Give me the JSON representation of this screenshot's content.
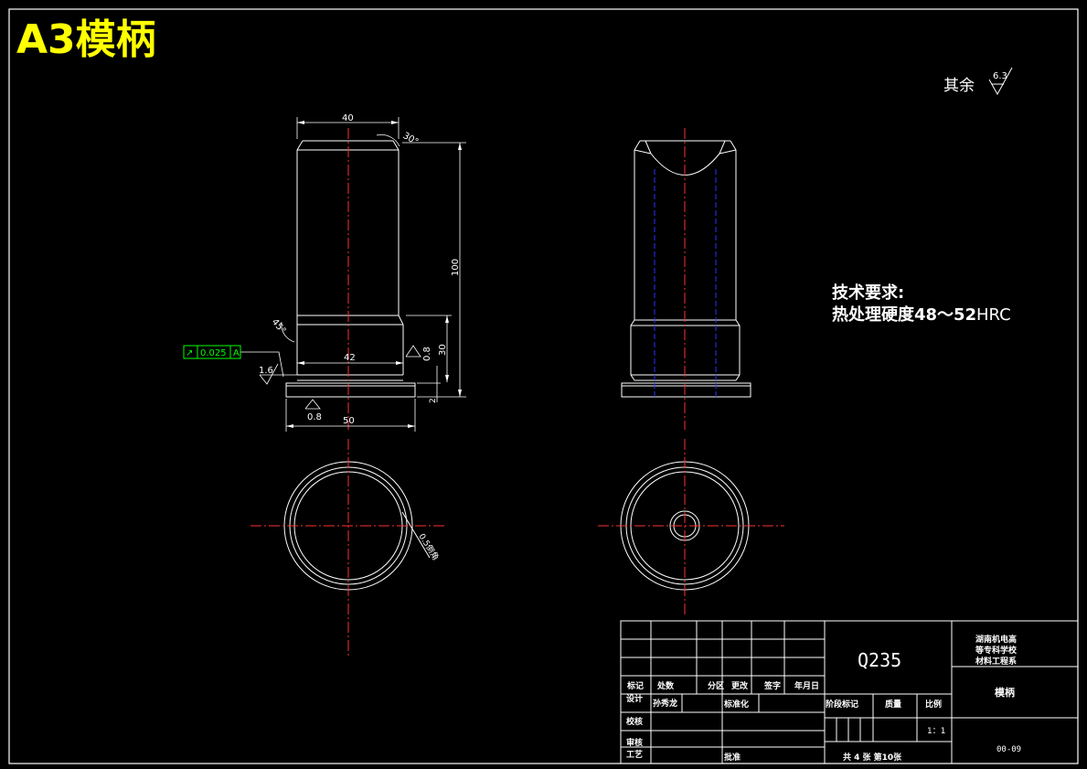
{
  "drawing": {
    "title": "A3模柄",
    "roughness_note": {
      "label": "其余",
      "value": "6.3"
    },
    "tech_requirements": {
      "heading": "技术要求:",
      "line1": "热处理硬度48～52",
      "line1_unit": "HRC"
    },
    "dimensions": {
      "top_width": "40",
      "chamfer_angle": "30°",
      "total_height": "100",
      "neck_angle": "45°",
      "neck_diameter": "42",
      "neck_height": "30",
      "flange_width": "50",
      "flange_thickness": "2",
      "roughness_left": "1.6",
      "roughness_right": "0.8",
      "roughness_bottom": "0.8",
      "tolerance_symbol": "↗",
      "tolerance_value": "0.025",
      "tolerance_datum": "A",
      "circle_note": "0.5倒角"
    }
  },
  "title_block": {
    "material": "Q235",
    "school_line1": "湖南机电高",
    "school_line2": "等专科学校",
    "school_line3": "材料工程系",
    "part_name": "模柄",
    "drawing_no": "00-09",
    "col_labels": [
      "标记",
      "处数",
      "分区",
      "更改",
      "签字",
      "年月日"
    ],
    "design_label": "设计",
    "designer": "孙秀龙",
    "standardization": "标准化",
    "check_label": "校核",
    "review_label": "审核",
    "process_label": "工艺",
    "approve_label": "批准",
    "stage_mark": "阶段标记",
    "weight": "质量",
    "scale_label": "比例",
    "scale_value": "1：1",
    "sheets": "共 4 张  第10张"
  }
}
